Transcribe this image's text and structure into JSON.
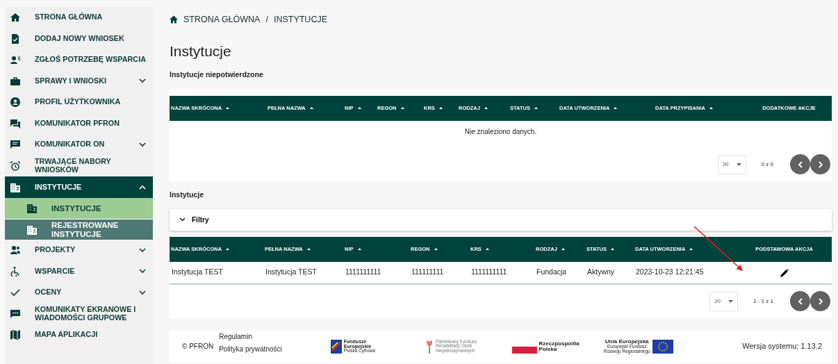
{
  "sidebar": {
    "items": [
      {
        "label": "STRONA GŁÓWNA",
        "selected": false
      },
      {
        "label": "DODAJ NOWY WNIOSEK",
        "selected": false
      },
      {
        "label": "ZGŁOŚ POTRZEBĘ WSPARCIA",
        "selected": false
      },
      {
        "label": "SPRAWY I WNIOSKI",
        "selected": false,
        "expanded": false
      },
      {
        "label": "PROFIL UŻYTKOWNIKA",
        "selected": false
      },
      {
        "label": "KOMUNIKATOR PFRON",
        "selected": false
      },
      {
        "label": "KOMUNIKATOR ON",
        "selected": false,
        "expanded": false
      },
      {
        "label": "TRWAJĄCE NABORY WNIOSKÓW",
        "selected": false
      },
      {
        "label": "INSTYTUCJE",
        "selected": true,
        "expanded": true,
        "children": [
          {
            "label": "INSTYTUCJE",
            "selected": true,
            "hovered": false
          },
          {
            "label": "REJESTROWANE INSTYTUCJE",
            "selected": false,
            "hovered": true
          }
        ]
      },
      {
        "label": "PROJEKTY",
        "selected": false,
        "expanded": false
      },
      {
        "label": "WSPARCIE",
        "selected": false,
        "expanded": false
      },
      {
        "label": "OCENY",
        "selected": false,
        "expanded": false
      },
      {
        "label": "KOMUNIKATY EKRANOWE I WIADOMOŚCI GRUPOWE",
        "selected": false
      },
      {
        "label": "MAPA APLIKACJI",
        "selected": false
      }
    ]
  },
  "breadcrumb": [
    "STRONA GŁÓWNA",
    "/",
    "INSTYTUCJE"
  ],
  "page_title": "Instytucje",
  "sections": [
    {
      "title": "Instytucje niepotwierdzone",
      "table": {
        "columns": [
          {
            "label": "NAZWA SKRÓCONA",
            "sortable": true
          },
          {
            "label": "PEŁNA NAZWA",
            "sortable": true
          },
          {
            "label": "NIP",
            "sortable": true
          },
          {
            "label": "REGON",
            "sortable": true
          },
          {
            "label": "KRS",
            "sortable": true
          },
          {
            "label": "RODZAJ",
            "sortable": true
          },
          {
            "label": "STATUS",
            "sortable": true
          },
          {
            "label": "DATA UTWORZENIA",
            "sortable": true
          },
          {
            "label": "DATA PRZYPISANIA",
            "sortable": true
          },
          {
            "label": "DODATKOWE AKCJE",
            "sortable": false
          }
        ],
        "empty_message": "Nie znaleziono danych."
      },
      "paginator": {
        "page_size": "20",
        "range": "0 z 0"
      }
    },
    {
      "title": "Instytucje",
      "filters": {
        "label": "Filtry",
        "expanded": false
      },
      "table": {
        "columns": [
          {
            "label": "NAZWA SKRÓCONA",
            "sortable": true
          },
          {
            "label": "PEŁNA NAZWA",
            "sortable": true
          },
          {
            "label": "NIP",
            "sortable": true
          },
          {
            "label": "REGON",
            "sortable": true
          },
          {
            "label": "KRS",
            "sortable": true
          },
          {
            "label": "RODZAJ",
            "sortable": true
          },
          {
            "label": "STATUS",
            "sortable": true
          },
          {
            "label": "DATA UTWORZENIA",
            "sortable": true
          },
          {
            "label": "PODSTAWOWA AKCJA",
            "sortable": false
          }
        ],
        "rows": [
          [
            "Instytucja TEST",
            "Instytucja TEST",
            "1111111111",
            "111111111",
            "1111111111",
            "Fundacja",
            "Aktywny",
            "2023-10-23 12:21:45",
            {
              "kind": "edit"
            }
          ]
        ]
      },
      "paginator": {
        "page_size": "20",
        "range": "1 - 1 z 1"
      }
    }
  ],
  "footer": {
    "copyright": "© PFRON",
    "links": [
      "Regulamin",
      "Polityka prywatności"
    ],
    "logos": [
      [
        "Fundusze",
        "Europejskie",
        "Polska Cyfrowa"
      ],
      [
        "Państwowy Fundusz",
        "Rehabilitacji Osób",
        "Niepełnosprawnych"
      ],
      [
        "Rzeczpospolita",
        "Polska"
      ],
      [
        "Unia Europejska",
        "Europejski Fundusz",
        "Rozwoju Regionalnego"
      ]
    ],
    "version": "Wersja systemu: 1.13.2"
  }
}
